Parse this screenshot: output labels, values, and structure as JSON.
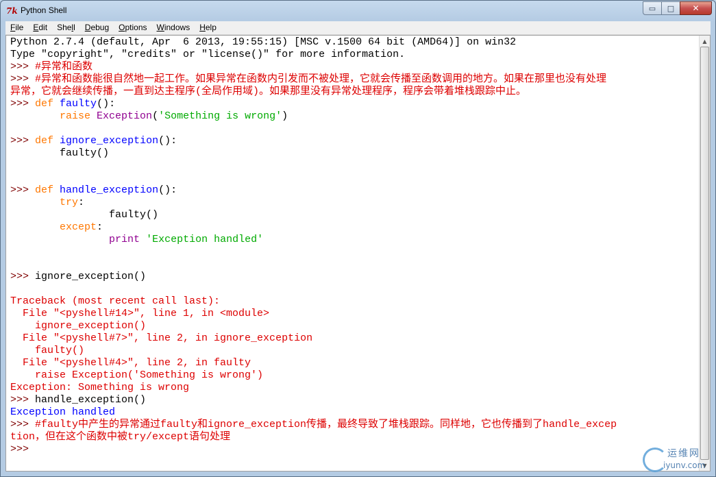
{
  "window": {
    "title": "Python Shell"
  },
  "caption_buttons": {
    "minimize": "▭",
    "maximize": "□",
    "close": "✕"
  },
  "menu": [
    {
      "u": "F",
      "rest": "ile"
    },
    {
      "u": "E",
      "rest": "dit"
    },
    {
      "u": "",
      "pre": "She",
      "u2": "l",
      "rest": "l"
    },
    {
      "u": "D",
      "rest": "ebug"
    },
    {
      "u": "O",
      "rest": "ptions"
    },
    {
      "u": "W",
      "rest": "indows"
    },
    {
      "u": "H",
      "rest": "elp"
    }
  ],
  "shell_lines": [
    [
      {
        "t": "Python 2.7.4 (default, Apr  6 2013, 19:55:15) [MSC v.1500 64 bit (AMD64)] on win32",
        "c": ""
      }
    ],
    [
      {
        "t": "Type \"copyright\", \"credits\" or \"license()\" for more information.",
        "c": ""
      }
    ],
    [
      {
        "t": ">>> ",
        "c": "c-prompt"
      },
      {
        "t": "#异常和函数",
        "c": "c-comment"
      }
    ],
    [
      {
        "t": ">>> ",
        "c": "c-prompt"
      },
      {
        "t": "#异常和函数能很自然地一起工作。如果异常在函数内引发而不被处理，它就会传播至函数调用的地方。如果在那里也没有处理",
        "c": "c-comment"
      }
    ],
    [
      {
        "t": "异常，它就会继续传播，一直到达主程序(全局作用域)。如果那里没有异常处理程序，程序会带着堆栈跟踪中止。",
        "c": "c-comment"
      }
    ],
    [
      {
        "t": ">>> ",
        "c": "c-prompt"
      },
      {
        "t": "def",
        "c": "c-kw"
      },
      {
        "t": " ",
        "c": ""
      },
      {
        "t": "faulty",
        "c": "c-def"
      },
      {
        "t": "():",
        "c": ""
      }
    ],
    [
      {
        "t": "        ",
        "c": ""
      },
      {
        "t": "raise",
        "c": "c-kw"
      },
      {
        "t": " ",
        "c": ""
      },
      {
        "t": "Exception",
        "c": "c-builtin"
      },
      {
        "t": "(",
        "c": ""
      },
      {
        "t": "'Something is wrong'",
        "c": "c-str"
      },
      {
        "t": ")",
        "c": ""
      }
    ],
    [
      {
        "t": "",
        "c": ""
      }
    ],
    [
      {
        "t": ">>> ",
        "c": "c-prompt"
      },
      {
        "t": "def",
        "c": "c-kw"
      },
      {
        "t": " ",
        "c": ""
      },
      {
        "t": "ignore_exception",
        "c": "c-def"
      },
      {
        "t": "():",
        "c": ""
      }
    ],
    [
      {
        "t": "        faulty()",
        "c": ""
      }
    ],
    [
      {
        "t": "",
        "c": ""
      }
    ],
    [
      {
        "t": "",
        "c": ""
      }
    ],
    [
      {
        "t": ">>> ",
        "c": "c-prompt"
      },
      {
        "t": "def",
        "c": "c-kw"
      },
      {
        "t": " ",
        "c": ""
      },
      {
        "t": "handle_exception",
        "c": "c-def"
      },
      {
        "t": "():",
        "c": ""
      }
    ],
    [
      {
        "t": "        ",
        "c": ""
      },
      {
        "t": "try",
        "c": "c-kw"
      },
      {
        "t": ":",
        "c": ""
      }
    ],
    [
      {
        "t": "                faulty()",
        "c": ""
      }
    ],
    [
      {
        "t": "        ",
        "c": ""
      },
      {
        "t": "except",
        "c": "c-kw"
      },
      {
        "t": ":",
        "c": ""
      }
    ],
    [
      {
        "t": "                ",
        "c": ""
      },
      {
        "t": "print",
        "c": "c-builtin"
      },
      {
        "t": " ",
        "c": ""
      },
      {
        "t": "'Exception handled'",
        "c": "c-str"
      }
    ],
    [
      {
        "t": "",
        "c": ""
      }
    ],
    [
      {
        "t": "",
        "c": ""
      }
    ],
    [
      {
        "t": ">>> ",
        "c": "c-prompt"
      },
      {
        "t": "ignore_exception()",
        "c": ""
      }
    ],
    [
      {
        "t": "",
        "c": ""
      }
    ],
    [
      {
        "t": "Traceback (most recent call last):",
        "c": "c-err"
      }
    ],
    [
      {
        "t": "  File \"<pyshell#14>\", line 1, in <module>",
        "c": "c-err"
      }
    ],
    [
      {
        "t": "    ignore_exception()",
        "c": "c-err"
      }
    ],
    [
      {
        "t": "  File \"<pyshell#7>\", line 2, in ignore_exception",
        "c": "c-err"
      }
    ],
    [
      {
        "t": "    faulty()",
        "c": "c-err"
      }
    ],
    [
      {
        "t": "  File \"<pyshell#4>\", line 2, in faulty",
        "c": "c-err"
      }
    ],
    [
      {
        "t": "    raise Exception('Something is wrong')",
        "c": "c-err"
      }
    ],
    [
      {
        "t": "Exception: Something is wrong",
        "c": "c-err"
      }
    ],
    [
      {
        "t": ">>> ",
        "c": "c-prompt"
      },
      {
        "t": "handle_exception()",
        "c": ""
      }
    ],
    [
      {
        "t": "Exception handled",
        "c": "c-out"
      }
    ],
    [
      {
        "t": ">>> ",
        "c": "c-prompt"
      },
      {
        "t": "#faulty中产生的异常通过faulty和ignore_exception传播，最终导致了堆栈跟踪。同样地，它也传播到了handle_excep",
        "c": "c-comment"
      }
    ],
    [
      {
        "t": "tion，但在这个函数中被try/except语句处理",
        "c": "c-comment"
      }
    ],
    [
      {
        "t": ">>> ",
        "c": "c-prompt"
      }
    ]
  ],
  "watermark": {
    "line1": "运维网",
    "line2": "iyunv.com"
  },
  "colors": {
    "prompt": "#7f0000",
    "comment": "#dd0000",
    "keyword": "#ff7700",
    "definition": "#0000ff",
    "builtin": "#900090",
    "string": "#00aa00",
    "stdout": "#0000ff"
  }
}
